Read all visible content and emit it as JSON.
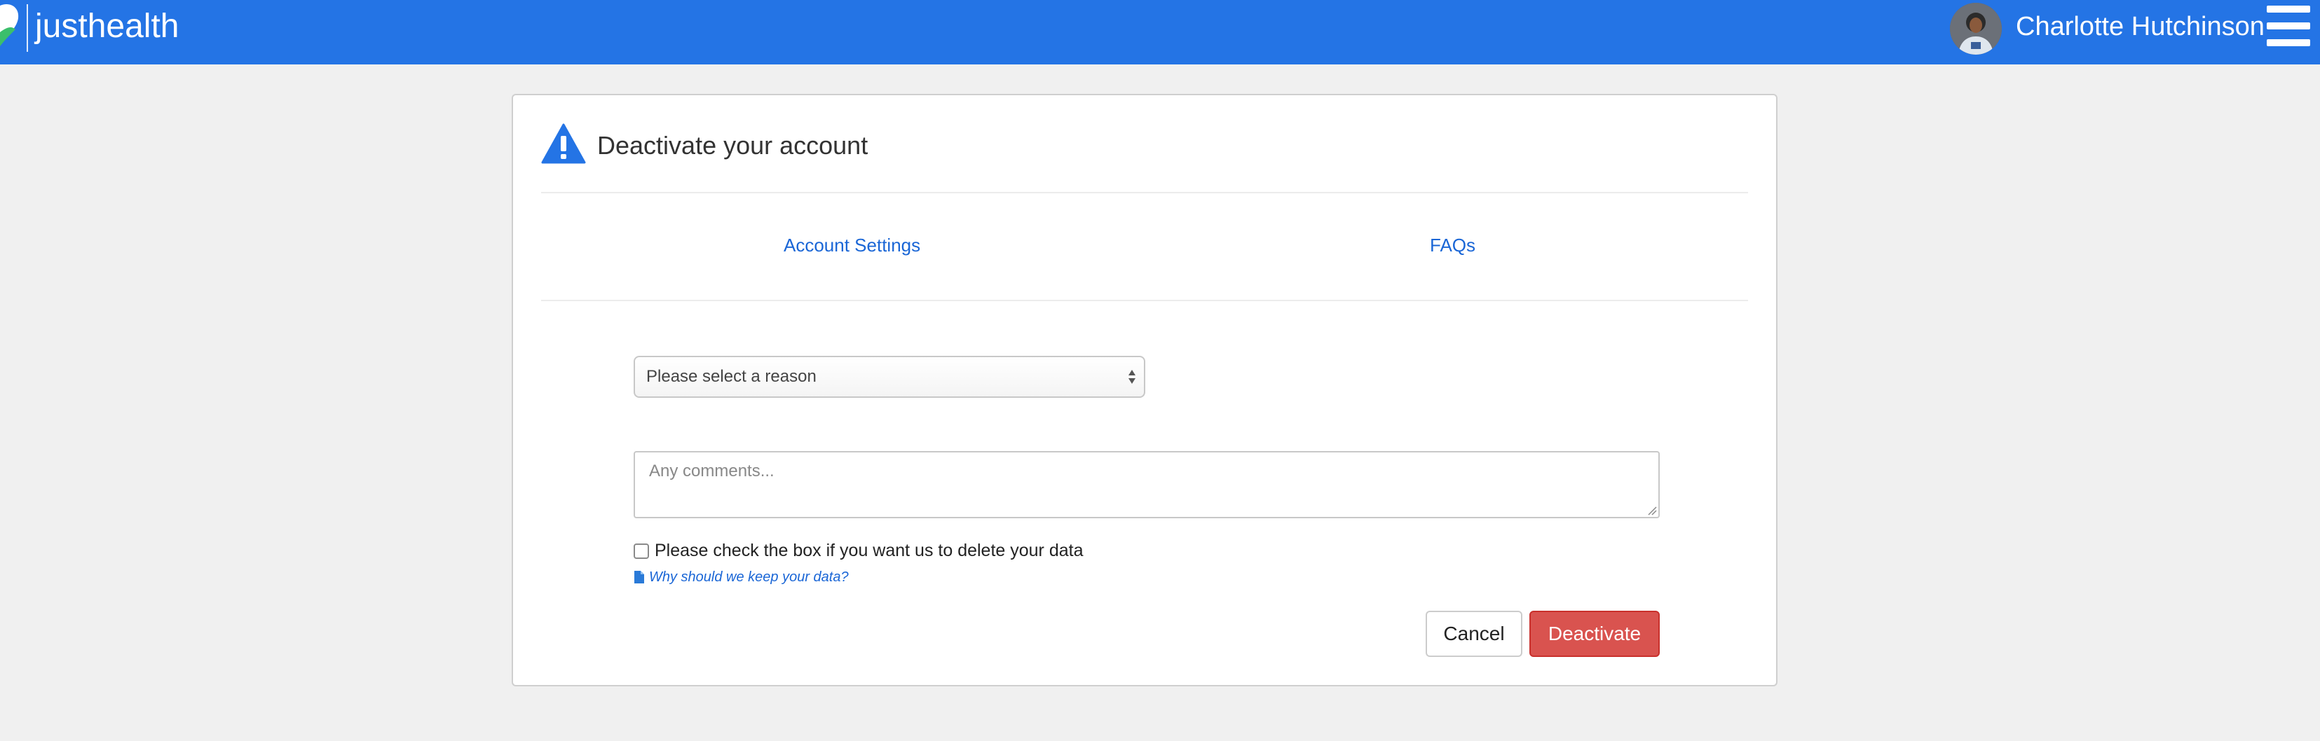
{
  "header": {
    "brand": "justhealth",
    "user_name": "Charlotte Hutchinson",
    "logo_icon": "heart-leaf-logo",
    "menu_icon": "hamburger-icon",
    "accent_color": "#2474e5"
  },
  "card": {
    "title": "Deactivate your account",
    "title_icon": "warning-icon",
    "nav": {
      "account_settings": "Account Settings",
      "faqs": "FAQs"
    },
    "form": {
      "reason_select": {
        "selected": "Please select a reason"
      },
      "comments": {
        "placeholder": "Any comments...",
        "value": ""
      },
      "delete_checkbox": {
        "label": "Please check the box if you want us to delete your data",
        "checked": false
      },
      "why_link": "Why should we keep your data?",
      "why_icon": "document-icon"
    },
    "buttons": {
      "cancel": "Cancel",
      "deactivate": "Deactivate",
      "deactivate_color": "#d9534f"
    }
  }
}
